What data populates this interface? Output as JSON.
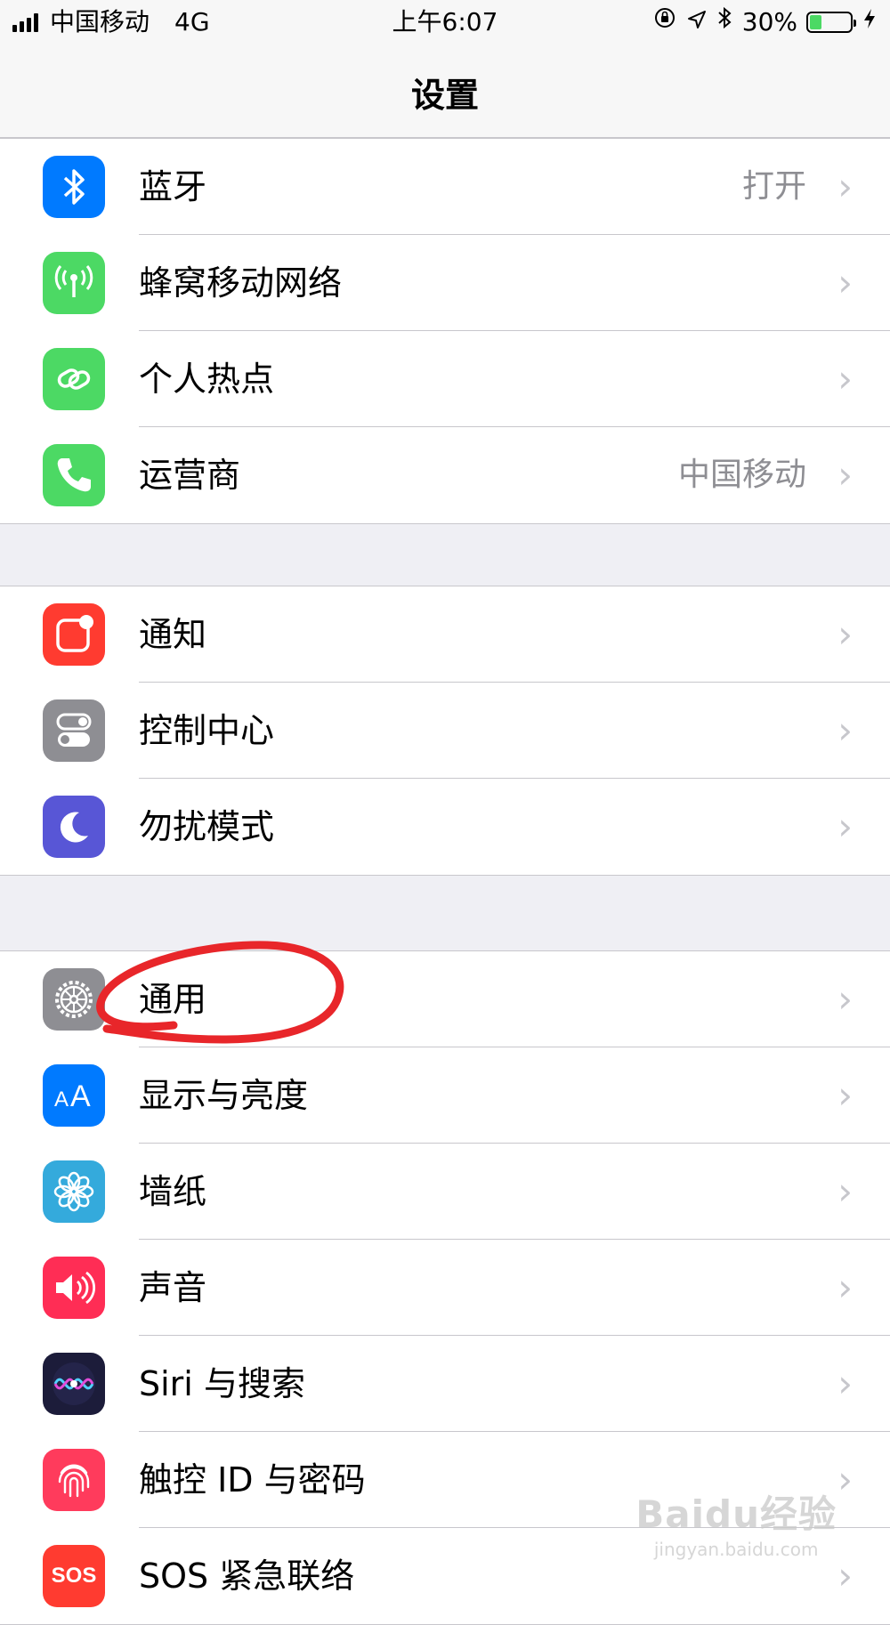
{
  "status_bar": {
    "carrier": "中国移动",
    "network": "4G",
    "time": "上午6:07",
    "battery": "30%",
    "battery_level": 0.3
  },
  "nav": {
    "title": "设置"
  },
  "groups": [
    [
      {
        "label": "蓝牙",
        "value": "打开",
        "icon": "bluetooth-icon",
        "color": "#007aff"
      },
      {
        "label": "蜂窝移动网络",
        "value": "",
        "icon": "cellular-icon",
        "color": "#4cd964"
      },
      {
        "label": "个人热点",
        "value": "",
        "icon": "hotspot-icon",
        "color": "#4cd964"
      },
      {
        "label": "运营商",
        "value": "中国移动",
        "icon": "phone-icon",
        "color": "#4cd964"
      }
    ],
    [
      {
        "label": "通知",
        "value": "",
        "icon": "notifications-icon",
        "color": "#ff3b30"
      },
      {
        "label": "控制中心",
        "value": "",
        "icon": "control-center-icon",
        "color": "#8e8e93"
      },
      {
        "label": "勿扰模式",
        "value": "",
        "icon": "moon-icon",
        "color": "#5856d6"
      }
    ],
    [
      {
        "label": "通用",
        "value": "",
        "icon": "gear-icon",
        "color": "#8e8e93"
      },
      {
        "label": "显示与亮度",
        "value": "",
        "icon": "display-icon",
        "color": "#007aff"
      },
      {
        "label": "墙纸",
        "value": "",
        "icon": "wallpaper-icon",
        "color": "#34aadc"
      },
      {
        "label": "声音",
        "value": "",
        "icon": "sound-icon",
        "color": "#ff2d55"
      },
      {
        "label": "Siri 与搜索",
        "value": "",
        "icon": "siri-icon",
        "color": "#1c1c3a"
      },
      {
        "label": "触控 ID 与密码",
        "value": "",
        "icon": "fingerprint-icon",
        "color": "#ff3b5c"
      },
      {
        "label": "SOS 紧急联络",
        "value": "",
        "icon": "sos-icon",
        "color": "#ff3b30"
      }
    ]
  ],
  "watermark": {
    "main": "Baidu经验",
    "sub": "jingyan.baidu.com"
  },
  "annotation": {
    "color": "#e8262a"
  }
}
